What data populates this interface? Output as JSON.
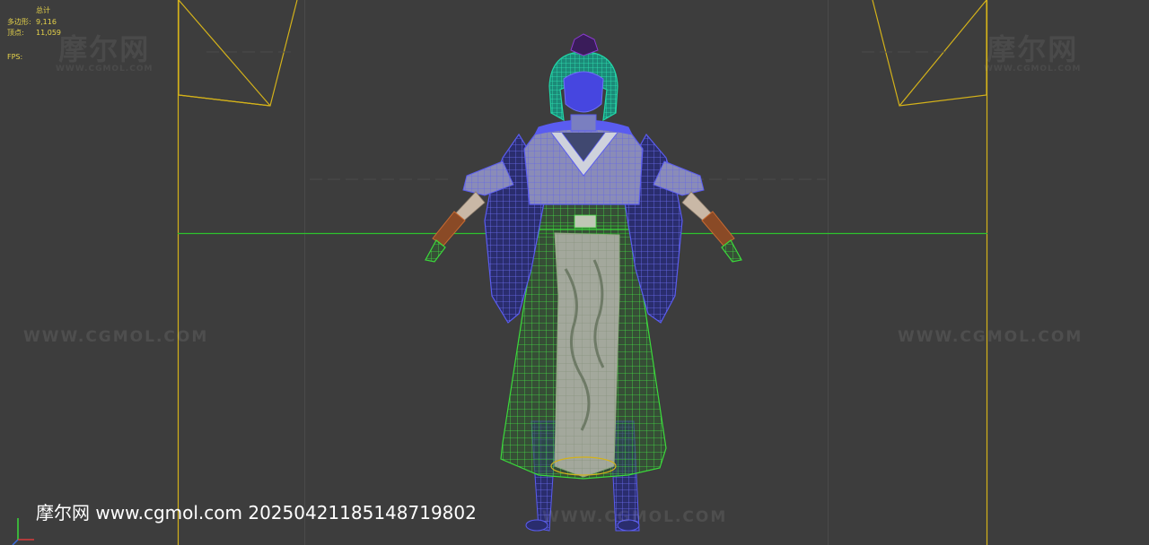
{
  "viewport_stats": {
    "title": "总计",
    "polygons_label": "多边形:",
    "polygons_value": "9,116",
    "vertices_label": "顶点:",
    "vertices_value": "11,059",
    "fps_label": "FPS:"
  },
  "watermarks": {
    "logo_cn": "摩尔网",
    "logo_en": "WWW.CGMOL.COM",
    "url": "WWW.CGMOL.COM"
  },
  "caption": "摩尔网 www.cgmol.com 20250421185148719802",
  "colors": {
    "background": "#3d3d3d",
    "safe_frame": "#d4b21a",
    "horizon_line": "#2ec22e",
    "wire_blue": "#5a5cf0",
    "wire_green": "#3bd93b",
    "wire_cyan": "#20d8a8",
    "stats_text": "#e6d34a"
  }
}
